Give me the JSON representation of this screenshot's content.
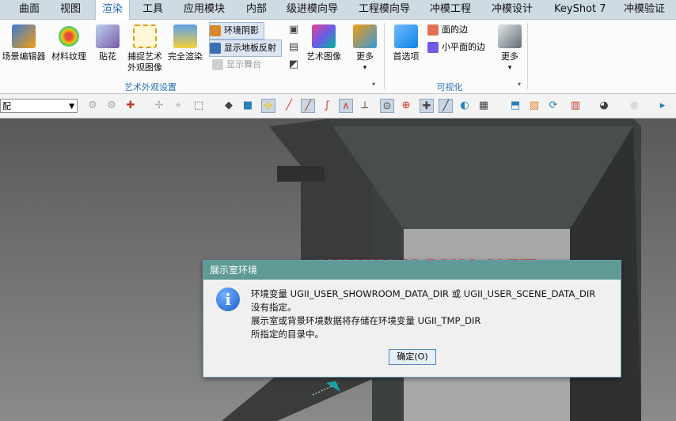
{
  "tabs": [
    "曲面",
    "视图",
    "渲染",
    "工具",
    "应用模块",
    "内部",
    "级进模向导",
    "工程模向导",
    "冲模工程",
    "冲模设计",
    "KeyShot 7",
    "冲模验证"
  ],
  "ribbon": {
    "scene_editor": "场景编辑器",
    "material_texture": "材料纹理",
    "decal": "贴花",
    "capture_art_1": "捕捉艺术",
    "capture_art_2": "外观图像",
    "full_render": "完全渲染",
    "env_shadow": "环境阴影",
    "show_floor_reflect": "显示地板反射",
    "show_stage": "显示舞台",
    "art_image": "艺术图像",
    "more": "更多",
    "group_art": "艺术外观设置",
    "preferences": "首选项",
    "face_edges": "面的边",
    "small_face_edges": "小平面的边",
    "more2": "更多",
    "group_vis": "可视化"
  },
  "toolbar": {
    "combo_value": "配"
  },
  "dialog": {
    "title": "展示室环境",
    "line1": "环境变量 UGII_USER_SHOWROOM_DATA_DIR 或 UGII_USER_SCENE_DATA_DIR",
    "line2": "没有指定。",
    "line3": "展示室或背景环境数据将存储在环境变量 UGII_TMP_DIR",
    "line4": "所指定的目录中。",
    "ok": "确定(O)"
  },
  "watermark": "WWW.UGNX.NET",
  "colors": {
    "accent": "#2a6fb7",
    "dialog_title": "#5f9a95"
  }
}
